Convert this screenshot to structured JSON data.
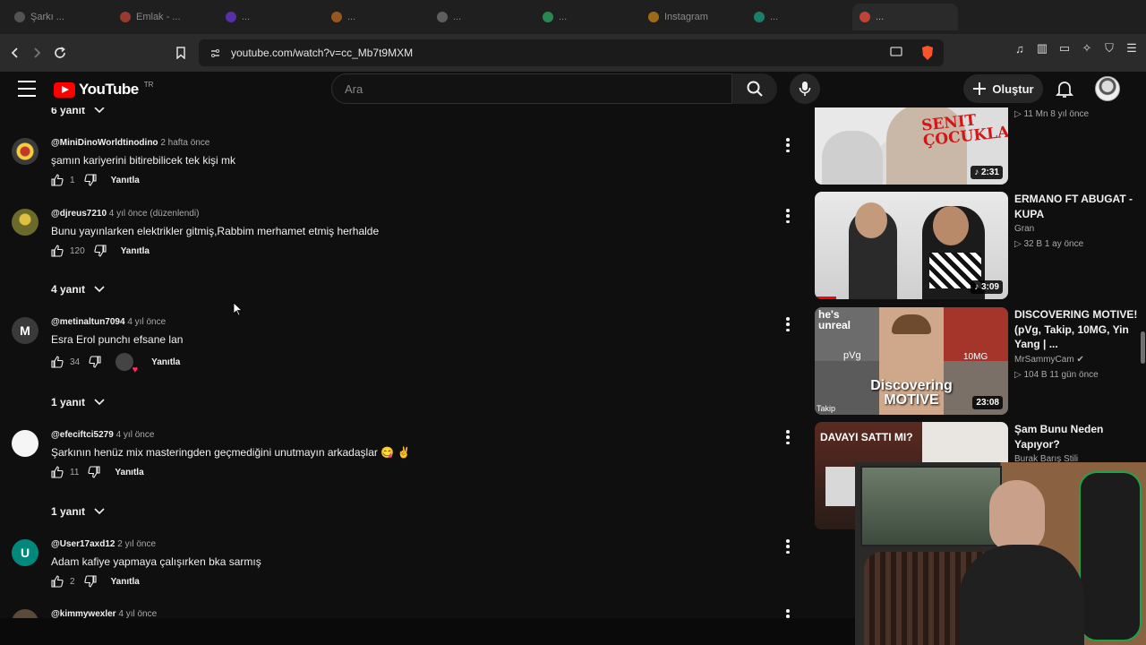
{
  "browser": {
    "tabs": [
      {
        "label": "Şarkı ... ",
        "color": "#777"
      },
      {
        "label": "Emlak - ...",
        "color": "#e74c3c"
      },
      {
        "label": "...",
        "color": "#7d3cff"
      },
      {
        "label": "...",
        "color": "#e67e22"
      },
      {
        "label": "...",
        "color": "#888"
      },
      {
        "label": "...",
        "color": "#2ecc71"
      },
      {
        "label": "Instagram",
        "color": "#f39c12"
      },
      {
        "label": "...",
        "color": "#1abc9c"
      },
      {
        "label": "...",
        "color": "#e74c3c"
      }
    ],
    "url": "youtube.com/watch?v=cc_Mb7t9MXM"
  },
  "header": {
    "logo_text": "YouTube",
    "region": "TR",
    "search_placeholder": "Ara",
    "create_label": "Oluştur"
  },
  "comments": {
    "top_toggle": "6 yanıt",
    "items": [
      {
        "author": "@MiniDinoWorldtinodino",
        "time": "2 hafta önce",
        "text": "şamın kariyerini bitirebilicek tek kişi mk",
        "likes": "1",
        "reply": "Yanıtla",
        "avatar_letter": "",
        "avatar_color": "#3b3b3b"
      },
      {
        "author": "@djreus7210",
        "time": "4 yıl önce (düzenlendi)",
        "text": "Bunu yayınlarken elektrikler gitmiş,Rabbim merhamet etmiş herhalde",
        "likes": "120",
        "reply": "Yanıtla",
        "avatar_letter": "",
        "avatar_color": "#6b6a2a",
        "replies_toggle": "4 yanıt"
      },
      {
        "author": "@metinaltun7094",
        "time": "4 yıl önce",
        "text": "Esra Erol punchı efsane lan",
        "likes": "34",
        "reply": "Yanıtla",
        "avatar_letter": "M",
        "avatar_color": "#3a3a3a",
        "replies_toggle": "1 yanıt"
      },
      {
        "author": "@efeciftci5279",
        "time": "4 yıl önce",
        "text": "Şarkının henüz mix masteringden geçmediğini unutmayın arkadaşlar 😋 ✌",
        "likes": "11",
        "reply": "Yanıtla",
        "avatar_letter": "",
        "avatar_color": "#f5f5f5",
        "replies_toggle": "1 yanıt"
      },
      {
        "author": "@User17axd12",
        "time": "2 yıl önce",
        "text": "Adam kafiye yapmaya çalışırken bka sarmış",
        "likes": "2",
        "reply": "Yanıtla",
        "avatar_letter": "U",
        "avatar_color": "#00897b"
      },
      {
        "author": "@kimmywexler",
        "time": "4 yıl önce",
        "text": "",
        "likes": "",
        "reply": "",
        "avatar_letter": "",
        "avatar_color": "#5a4a3a"
      }
    ]
  },
  "sidebar": {
    "videos": [
      {
        "title": "",
        "channel": "",
        "meta": "▷ 11 Mn  8 yıl önce",
        "duration": "♪ 2:31"
      },
      {
        "title": "ERMANO FT ABUGAT - KUPA",
        "channel": "Gran",
        "meta": "▷ 32 B  1 ay önce",
        "duration": "♪ 3:09"
      },
      {
        "title": "DISCOVERING MOTIVE! (pVg, Takip, 10MG, Yin Yang | ...",
        "channel": "MrSammyCam ✔",
        "meta": "▷ 104 B  11 gün önce",
        "duration": "23:08"
      },
      {
        "title": "Şam Bunu Neden Yapıyor?",
        "channel": "Burak Barış Stili",
        "meta": "",
        "duration": ""
      }
    ],
    "thumb_texts": {
      "t1": "SENIT ÇOCUKLARI",
      "t3_top": "he's unreal",
      "t3_main": "Discovering MOTIVE",
      "t3_pvg": "pVg",
      "t3_10mg": "10MG",
      "t3_takip": "Takip",
      "t4": "DAVAYI SATTI MI?"
    }
  }
}
